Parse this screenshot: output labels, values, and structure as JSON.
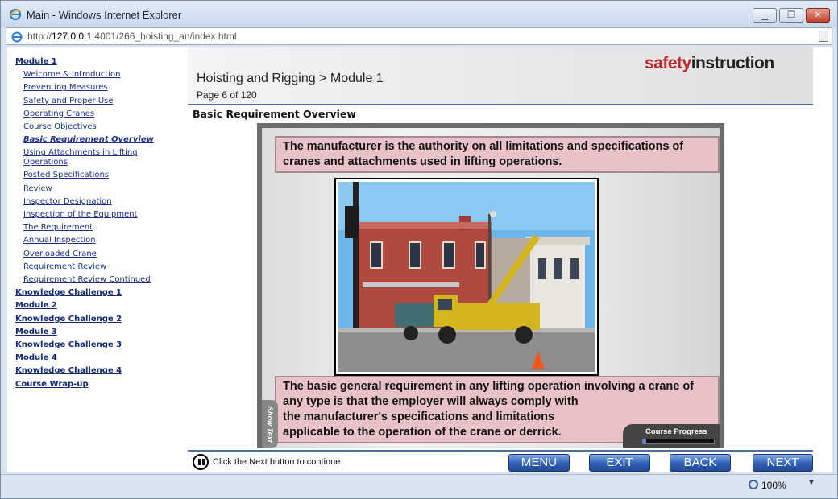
{
  "window": {
    "title": "Main - Windows Internet Explorer",
    "minimize": "▁",
    "maximize": "❐",
    "close": "✕"
  },
  "address": {
    "prefix": "http://",
    "host": "127.0.0.1",
    "rest": ":4001/266_hoisting_an/index.html"
  },
  "sidebar": {
    "items": [
      {
        "label": "Module 1",
        "type": "mod"
      },
      {
        "label": "Welcome & Introduction",
        "type": "sub"
      },
      {
        "label": "Preventing Measures",
        "type": "sub"
      },
      {
        "label": "Safety and Proper Use",
        "type": "sub"
      },
      {
        "label": "Operating Cranes",
        "type": "sub"
      },
      {
        "label": "Course Objectives",
        "type": "sub"
      },
      {
        "label": "Basic Requirement Overview",
        "type": "sub current"
      },
      {
        "label": "Using Attachments in Lifting Operations",
        "type": "sub wrap"
      },
      {
        "label": "Posted Specifications",
        "type": "sub"
      },
      {
        "label": "Review",
        "type": "sub"
      },
      {
        "label": "Inspector Designation",
        "type": "sub"
      },
      {
        "label": "Inspection of the Equipment",
        "type": "sub"
      },
      {
        "label": "The Requirement",
        "type": "sub"
      },
      {
        "label": "Annual Inspection",
        "type": "sub"
      },
      {
        "label": "Overloaded Crane",
        "type": "sub"
      },
      {
        "label": "Requirement Review",
        "type": "sub"
      },
      {
        "label": "Requirement Review Continued",
        "type": "sub"
      },
      {
        "label": "Knowledge Challenge 1",
        "type": "mod"
      },
      {
        "label": "Module 2",
        "type": "mod"
      },
      {
        "label": "Knowledge Challenge 2",
        "type": "mod"
      },
      {
        "label": "Module 3",
        "type": "mod"
      },
      {
        "label": "Knowledge Challenge 3",
        "type": "mod"
      },
      {
        "label": "Module 4",
        "type": "mod"
      },
      {
        "label": "Knowledge Challenge 4",
        "type": "mod"
      },
      {
        "label": "Course Wrap-up",
        "type": "mod"
      }
    ]
  },
  "header": {
    "breadcrumb": "Hoisting and Rigging > Module 1",
    "page": "Page 6 of 120",
    "logo_part1": "safety",
    "logo_part2": "instruction"
  },
  "section_title": "Basic Requirement Overview",
  "slide": {
    "caption_top": "The manufacturer is the authority on all limitations and specifications of cranes and attachments used in lifting operations.",
    "caption_bottom_lines": [
      "The basic general requirement in any lifting operation involving a crane of",
      "any type is that the employer will always comply with",
      "the manufacturer's specifications and limitations",
      "applicable to the operation of the crane or derrick."
    ],
    "show_text": "Show Text",
    "progress_label": "Course Progress",
    "progress_fraction": 0.05
  },
  "footer": {
    "hint": "Click the Next button to continue.",
    "menu": "MENU",
    "exit": "EXIT",
    "back": "BACK",
    "next": "NEXT"
  },
  "status": {
    "zoom": "100%",
    "caret": "▼"
  },
  "colors": {
    "accent": "#4a6fa1",
    "caption_bg": "#e8c2c7",
    "link": "#1a2f8a",
    "logo_red": "#c0282d"
  }
}
